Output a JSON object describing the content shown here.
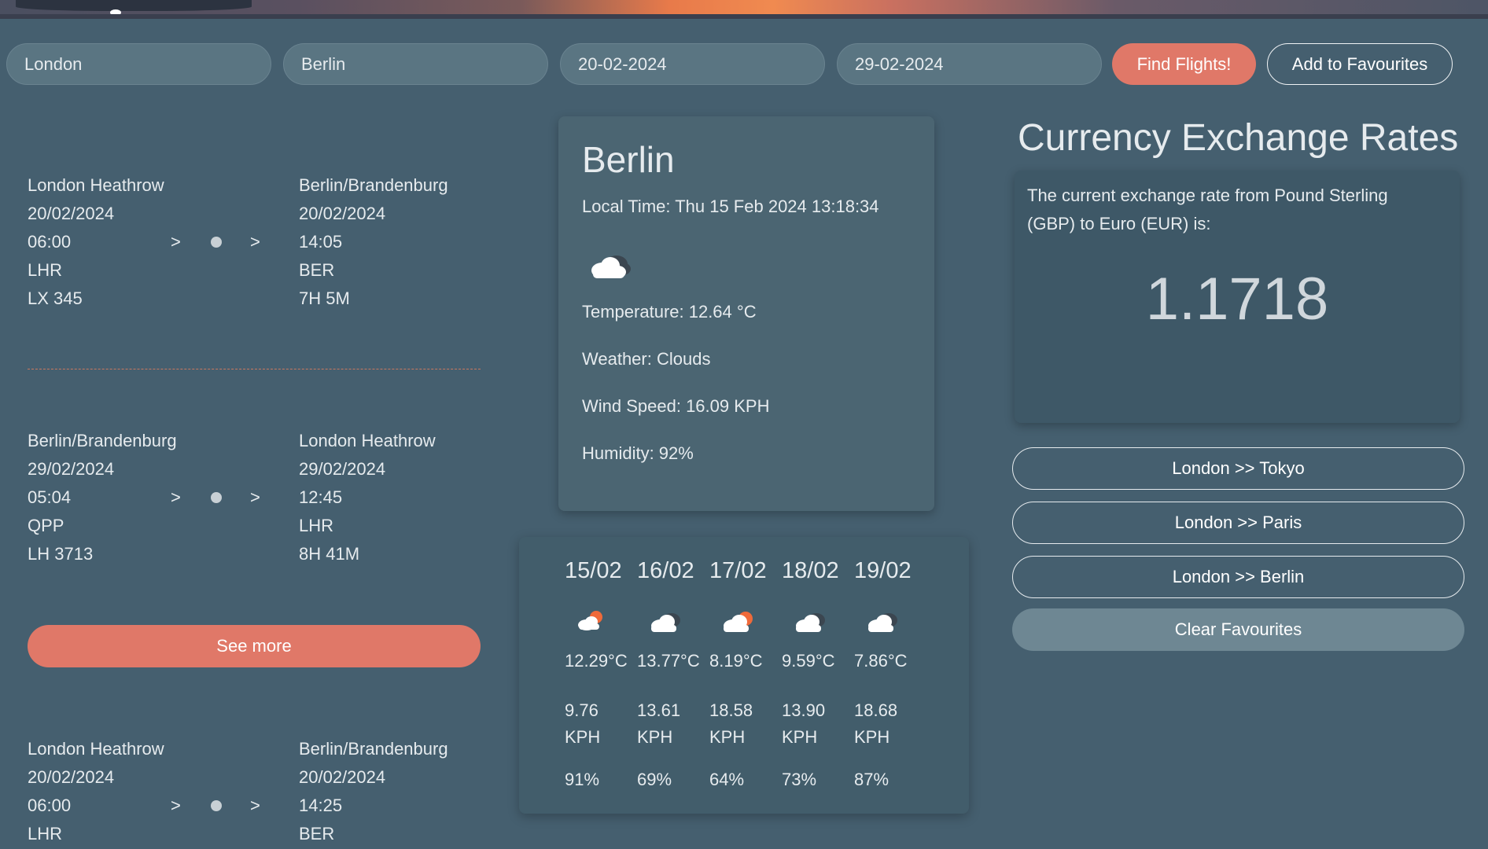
{
  "search": {
    "from": "London",
    "to": "Berlin",
    "depart": "20-02-2024",
    "return": "29-02-2024",
    "find_label": "Find Flights!",
    "fav_label": "Add to Favourites"
  },
  "flights": [
    {
      "origin": "London Heathrow",
      "origin_date": "20/02/2024",
      "origin_time": "06:00",
      "origin_code": "LHR",
      "flight_no": "LX 345",
      "dest": "Berlin/Brandenburg",
      "dest_date": "20/02/2024",
      "dest_time": "14:05",
      "dest_code": "BER",
      "duration": "7H 5M",
      "arrow": ">"
    },
    {
      "origin": "Berlin/Brandenburg",
      "origin_date": "29/02/2024",
      "origin_time": "05:04",
      "origin_code": "QPP",
      "flight_no": "LH 3713",
      "dest": "London Heathrow",
      "dest_date": "29/02/2024",
      "dest_time": "12:45",
      "dest_code": "LHR",
      "duration": "8H 41M",
      "arrow": ">"
    },
    {
      "origin": "London Heathrow",
      "origin_date": "20/02/2024",
      "origin_time": "06:00",
      "origin_code": "LHR",
      "dest": "Berlin/Brandenburg",
      "dest_date": "20/02/2024",
      "dest_time": "14:25",
      "dest_code": "BER",
      "arrow": ">"
    }
  ],
  "see_more_label": "See more",
  "weather": {
    "city": "Berlin",
    "local_time": "Local Time: Thu 15 Feb 2024  13:18:34",
    "icon": "cloud-icon",
    "temperature": "Temperature: 12.64 °C",
    "condition": "Weather: Clouds",
    "wind": "Wind Speed: 16.09 KPH",
    "humidity": "Humidity: 92%"
  },
  "forecast": [
    {
      "date": "15/02",
      "icon": "sun-cloud-icon",
      "temp": "12.29°C",
      "wind_value": "9.76",
      "wind_unit": "KPH",
      "humidity": "91%"
    },
    {
      "date": "16/02",
      "icon": "cloud-icon",
      "temp": "13.77°C",
      "wind_value": "13.61",
      "wind_unit": "KPH",
      "humidity": "69%"
    },
    {
      "date": "17/02",
      "icon": "sun-cloud-icon",
      "temp": "8.19°C",
      "wind_value": "18.58",
      "wind_unit": "KPH",
      "humidity": "64%"
    },
    {
      "date": "18/02",
      "icon": "cloud-icon",
      "temp": "9.59°C",
      "wind_value": "13.90",
      "wind_unit": "KPH",
      "humidity": "73%"
    },
    {
      "date": "19/02",
      "icon": "cloud-icon",
      "temp": "7.86°C",
      "wind_value": "18.68",
      "wind_unit": "KPH",
      "humidity": "87%"
    }
  ],
  "currency": {
    "title": "Currency Exchange Rates",
    "description": "The current exchange rate from Pound Sterling (GBP) to Euro (EUR) is:",
    "rate": "1.1718"
  },
  "favourites": [
    {
      "label": "London >> Tokyo"
    },
    {
      "label": "London >> Paris"
    },
    {
      "label": "London >> Berlin"
    }
  ],
  "clear_favourites_label": "Clear Favourites",
  "colors": {
    "background": "#455f6f",
    "accent": "#e07868",
    "card": "#4b6572",
    "text": "#e6ebee"
  }
}
